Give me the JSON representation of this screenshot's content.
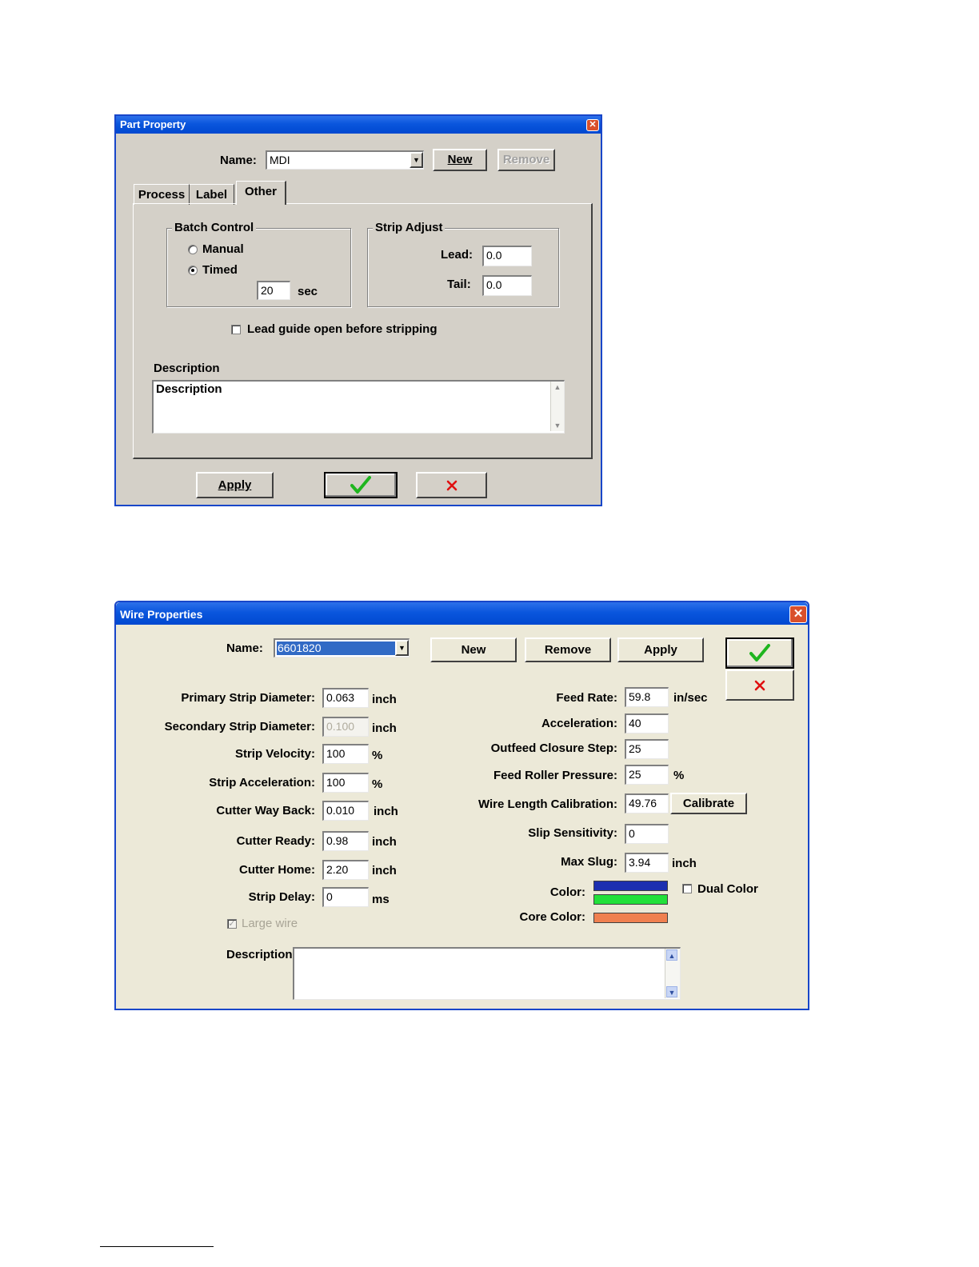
{
  "part_property": {
    "title": "Part Property",
    "name_label": "Name:",
    "name_value": "MDI",
    "new_button": "New",
    "remove_button": "Remove",
    "tabs": [
      "Process",
      "Label",
      "Other"
    ],
    "active_tab": "Other",
    "batch_control": {
      "title": "Batch Control",
      "manual_label": "Manual",
      "timed_label": "Timed",
      "selected": "Timed",
      "timed_value": "20",
      "timed_unit": "sec"
    },
    "strip_adjust": {
      "title": "Strip Adjust",
      "lead_label": "Lead:",
      "lead_value": "0.0",
      "tail_label": "Tail:",
      "tail_value": "0.0"
    },
    "lead_guide_label": "Lead guide open before stripping",
    "lead_guide_checked": false,
    "description_label": "Description",
    "description_value": "Description",
    "apply_button": "Apply",
    "ok_icon": "check-icon",
    "cancel_icon": "x-icon"
  },
  "wire_properties": {
    "title": "Wire Properties",
    "name_label": "Name:",
    "name_value": "6601820",
    "new_button": "New",
    "remove_button": "Remove",
    "apply_button": "Apply",
    "ok_icon": "check-icon",
    "cancel_icon": "x-icon",
    "left_fields": [
      {
        "label": "Primary Strip Diameter:",
        "value": "0.063",
        "unit": "inch"
      },
      {
        "label": "Secondary Strip Diameter:",
        "value": "0.100",
        "unit": "inch"
      },
      {
        "label": "Strip Velocity:",
        "value": "100",
        "unit": "%"
      },
      {
        "label": "Strip Acceleration:",
        "value": "100",
        "unit": "%"
      },
      {
        "label": "Cutter Way Back:",
        "value": "0.010",
        "unit": "inch"
      },
      {
        "label": "Cutter Ready:",
        "value": "0.98",
        "unit": "inch"
      },
      {
        "label": "Cutter Home:",
        "value": "2.20",
        "unit": "inch"
      },
      {
        "label": "Strip Delay:",
        "value": "0",
        "unit": "ms"
      }
    ],
    "large_wire_label": "Large wire",
    "large_wire_checked": true,
    "right_fields": [
      {
        "label": "Feed Rate:",
        "value": "59.8",
        "unit": "in/sec"
      },
      {
        "label": "Acceleration:",
        "value": "40",
        "unit": ""
      },
      {
        "label": "Outfeed Closure Step:",
        "value": "25",
        "unit": ""
      },
      {
        "label": "Feed Roller Pressure:",
        "value": "25",
        "unit": "%"
      },
      {
        "label": "Wire Length Calibration:",
        "value": "49.76",
        "unit": ""
      },
      {
        "label": "Slip Sensitivity:",
        "value": "0",
        "unit": ""
      },
      {
        "label": "Max Slug:",
        "value": "3.94",
        "unit": "inch"
      }
    ],
    "calibrate_button": "Calibrate",
    "color_label": "Color:",
    "color_primary": "#1c2fb0",
    "color_secondary": "#22e03a",
    "dual_color_label": "Dual Color",
    "dual_color_checked": false,
    "core_color_label": "Core Color:",
    "core_color": "#f08050",
    "description_label": "Description",
    "description_value": ""
  }
}
